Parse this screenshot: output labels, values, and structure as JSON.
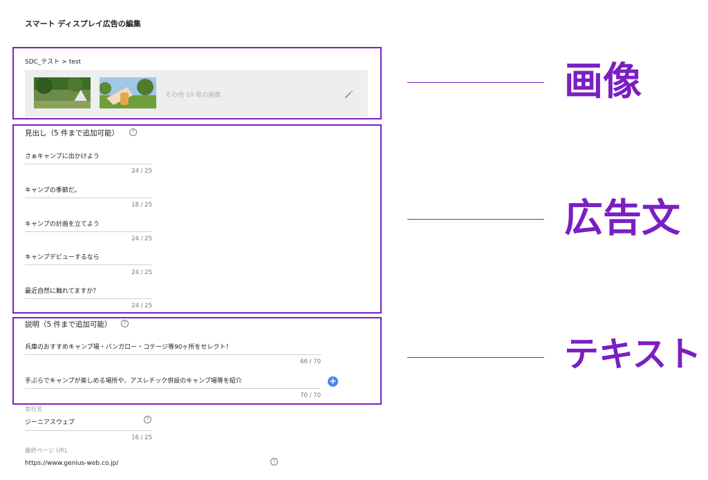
{
  "page": {
    "title": "スマート ディスプレイ広告の編集"
  },
  "breadcrumb": "SDC_テスト > test",
  "images": {
    "more_text": "その他 10 枚の画像"
  },
  "headlines": {
    "label": "見出し（5 件まで追加可能）",
    "items": [
      {
        "text": "さぁキャンプに出かけよう",
        "count": "24 / 25"
      },
      {
        "text": "キャンプの季節だ。",
        "count": "18 / 25"
      },
      {
        "text": "キャンプの計画を立てよう",
        "count": "24 / 25"
      },
      {
        "text": "キャンプデビューするなら",
        "count": "24 / 25"
      },
      {
        "text": "最近自然に触れてますか？",
        "count": "24 / 25"
      }
    ]
  },
  "descriptions": {
    "label": "説明（5 件まで追加可能）",
    "items": [
      {
        "text": "兵庫のおすすめキャンプ場・バンガロー・コテージ等90ヶ所をセレクト！",
        "count": "66 / 70"
      },
      {
        "text": "手ぶらでキャンプが楽しめる場所や、アスレチック併設のキャンプ場等を紹介",
        "count": "70 / 70"
      }
    ]
  },
  "company": {
    "label": "会社名",
    "value": "ジーニアスウェブ",
    "count": "16 / 25"
  },
  "final_url": {
    "label": "最終ページ URL",
    "value": "https://www.genius-web.co.jp/"
  },
  "annotations": {
    "images": "画像",
    "ad_text": "広告文",
    "text": "テキスト"
  },
  "icons": {
    "help": "?",
    "add": "+"
  },
  "colors": {
    "annotation": "#7a1fc2",
    "add_button": "#4285f4",
    "panel_bg": "#eeeeee"
  }
}
